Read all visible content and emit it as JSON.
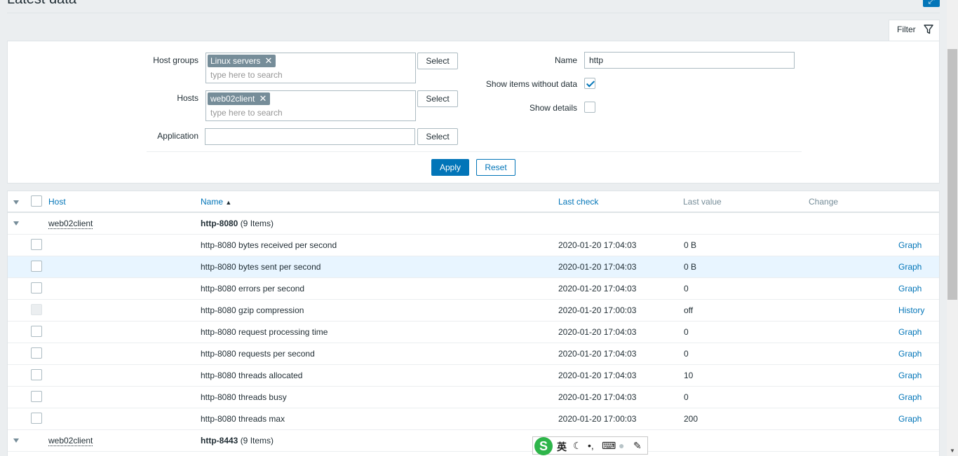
{
  "page": {
    "title": "Latest data",
    "fullscreen_icon": "expand-icon",
    "filter_tab_label": "Filter"
  },
  "filter": {
    "host_groups_label": "Host groups",
    "host_groups_chip": "Linux servers",
    "hosts_label": "Hosts",
    "hosts_chip": "web02client",
    "search_placeholder": "type here to search",
    "application_label": "Application",
    "application_value": "",
    "select_label": "Select",
    "name_label": "Name",
    "name_value": "http",
    "show_without_data_label": "Show items without data",
    "show_without_data_checked": true,
    "show_details_label": "Show details",
    "show_details_checked": false,
    "apply_label": "Apply",
    "reset_label": "Reset"
  },
  "table": {
    "headers": {
      "host": "Host",
      "name": "Name",
      "sort_indicator": "▲",
      "last_check": "Last check",
      "last_value": "Last value",
      "change": "Change"
    },
    "groups": [
      {
        "host": "web02client",
        "app": "http-8080",
        "count": "(9 Items)",
        "items": [
          {
            "name": "http-8080 bytes received per second",
            "last_check": "2020-01-20 17:04:03",
            "last_value": "0 B",
            "action": "Graph"
          },
          {
            "name": "http-8080 bytes sent per second",
            "last_check": "2020-01-20 17:04:03",
            "last_value": "0 B",
            "action": "Graph"
          },
          {
            "name": "http-8080 errors per second",
            "last_check": "2020-01-20 17:04:03",
            "last_value": "0",
            "action": "Graph"
          },
          {
            "name": "http-8080 gzip compression",
            "last_check": "2020-01-20 17:00:03",
            "last_value": "off",
            "action": "History"
          },
          {
            "name": "http-8080 request processing time",
            "last_check": "2020-01-20 17:04:03",
            "last_value": "0",
            "action": "Graph"
          },
          {
            "name": "http-8080 requests per second",
            "last_check": "2020-01-20 17:04:03",
            "last_value": "0",
            "action": "Graph"
          },
          {
            "name": "http-8080 threads allocated",
            "last_check": "2020-01-20 17:04:03",
            "last_value": "10",
            "action": "Graph"
          },
          {
            "name": "http-8080 threads busy",
            "last_check": "2020-01-20 17:04:03",
            "last_value": "0",
            "action": "Graph"
          },
          {
            "name": "http-8080 threads max",
            "last_check": "2020-01-20 17:00:03",
            "last_value": "200",
            "action": "Graph"
          }
        ]
      },
      {
        "host": "web02client",
        "app": "http-8443",
        "count": "(9 Items)"
      }
    ]
  },
  "ime": {
    "logo": "S",
    "lang": "英",
    "moon": "☾",
    "punct": "•,",
    "keyboard": "⌨",
    "user": "●",
    "tool": "✎"
  }
}
